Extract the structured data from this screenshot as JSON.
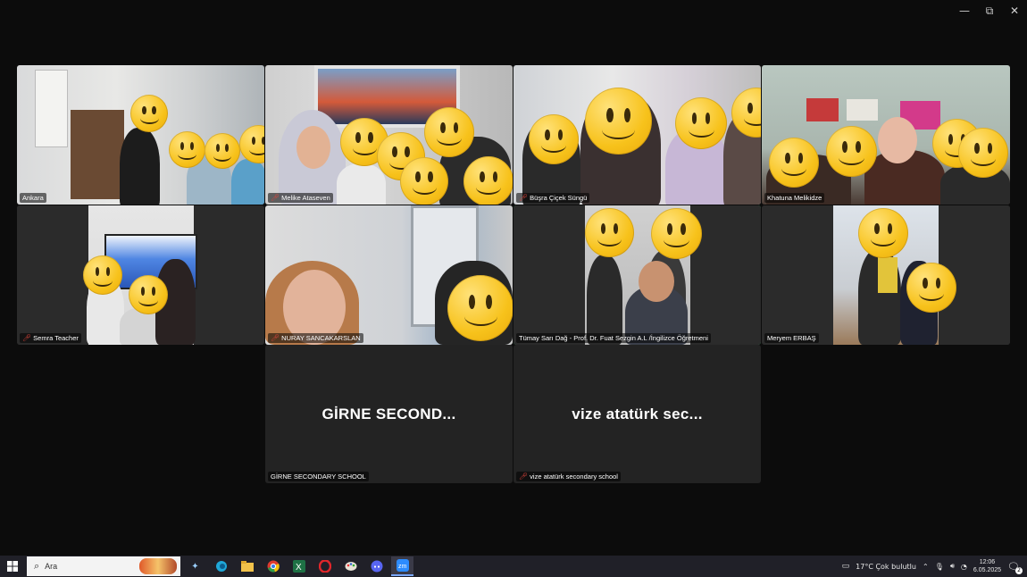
{
  "window_controls": {
    "minimize": "—",
    "restore": "⧉",
    "close": "✕"
  },
  "tiles": [
    {
      "id": "ankara",
      "name": "Ankara",
      "muted": false
    },
    {
      "id": "melike",
      "name": "Melike Ataseven",
      "muted": true
    },
    {
      "id": "busra",
      "name": "Büşra Çiçek Süngü",
      "muted": true
    },
    {
      "id": "khatuna",
      "name": "Khatuna Melikidze",
      "muted": false
    },
    {
      "id": "semra",
      "name": "Semra Teacher",
      "muted": true
    },
    {
      "id": "nuray",
      "name": "NURAY SANCAKARSLAN",
      "muted": true
    },
    {
      "id": "tumay",
      "name": "Tümay Sarı Dağ - Prof. Dr. Fuat Sezgin A.L /İngilizce Öğretmeni",
      "muted": false
    },
    {
      "id": "meryem",
      "name": "Meryem ERBAŞ",
      "muted": false
    },
    {
      "id": "girne",
      "name": "GİRNE SECONDARY SCHOOL",
      "display": "GİRNE SECOND...",
      "muted": false
    },
    {
      "id": "vize",
      "name": "vize atatürk secondary school",
      "display": "vize atatürk sec...",
      "muted": true
    }
  ],
  "taskbar": {
    "search_placeholder": "Ara",
    "weather": "17°C  Çok bulutlu",
    "time": "12:06",
    "date": "6.05.2025",
    "notifications": "2"
  }
}
